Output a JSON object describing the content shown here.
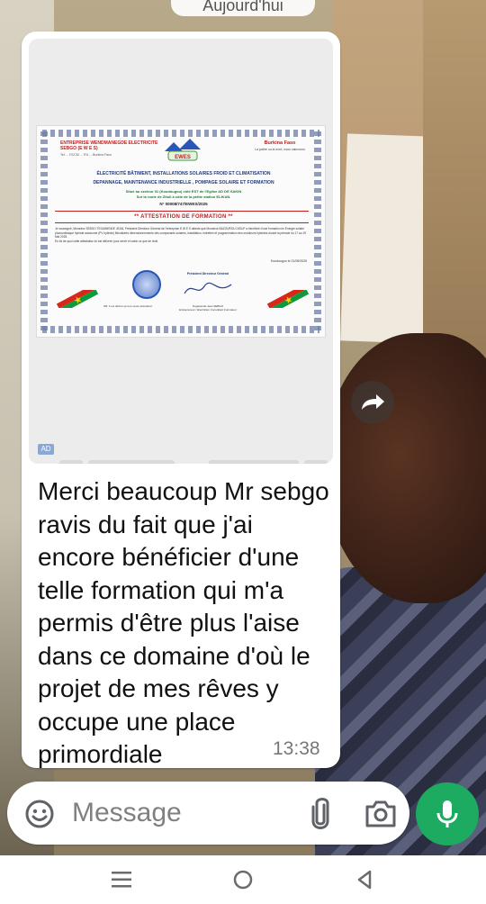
{
  "date_separator": "Aujourd'hui",
  "certificate": {
    "company_name": "ENTREPRISE WENDMANEGDE ELECTRICITE SEBGO (E W E S)",
    "company_details": "Tel: ... RCCM ... IFU ... Burkina Faso",
    "country": "Burkina Faso",
    "motto": "La patrie ou la mort, nous vaincrons",
    "services_line1": "ÉLECTRICITÉ BÂTIMENT, INSTALLATIONS SOLAIRES FROID ET CLIMATISATION",
    "services_line2": "DEPANNAGE, MAINTENANCE INDUSTRIELLE , POMPAGE SOLAIRE ET FORMATION",
    "address_line1": "Situé au secteur 01 (Koudougou) côté EST de l'Eglise AD DE SAKIN",
    "address_line2": "Sur la route de Zitoli à côté de la petite station ELIKAN.",
    "reference": "N° 00008/747/EWES/2025",
    "title": "** ATTESTATION DE FORMATION **",
    "body": "Je soussigné, Monsieur SEBGO TEGAWENDE JEAN, Président Directeur Général de l'entreprise E W E S atteste que Monsieur BAZOUROU DIOUF a bénéficié d'une formation en Énergie solaire photovoltaïque hybride autonome (PV hybride) Minutisées dimensionnements des composants solaires, installation, entretien et programmation des onduleurs hybrides durant la période du 17 au 19 Mai 2025.",
    "body_closing": "En foi de quoi cette attestation lui est délivrée pour servir et valoir ce que de droit.",
    "place_date": "Koudougou le 21/05/2025",
    "signatory_title": "Président Directeur Général",
    "signatory_name": "Tegawendé Jean SEBGO",
    "signatory_role": "Entrepreneur / Electricien Consultant Formateur",
    "footnote": "NB: Il est délivré qu'une seule attestation",
    "logo_text": "EWES"
  },
  "ad_label": "AD",
  "message": {
    "text": "Merci beaucoup Mr sebgo ravis du fait que j'ai encore bénéficier d'une telle formation qui m'a permis d'être plus l'aise dans ce domaine d'où le projet de mes rêves y occupe une place primordiale",
    "time": "13:38"
  },
  "composer": {
    "placeholder": "Message"
  },
  "icons": {
    "emoji": "emoji-icon",
    "attach": "paperclip-icon",
    "camera": "camera-icon",
    "mic": "microphone-icon",
    "forward": "forward-icon"
  },
  "colors": {
    "mic_button": "#1daa61",
    "bubble": "#ffffff",
    "cert_red": "#c31d1d",
    "cert_blue": "#223b7c"
  }
}
